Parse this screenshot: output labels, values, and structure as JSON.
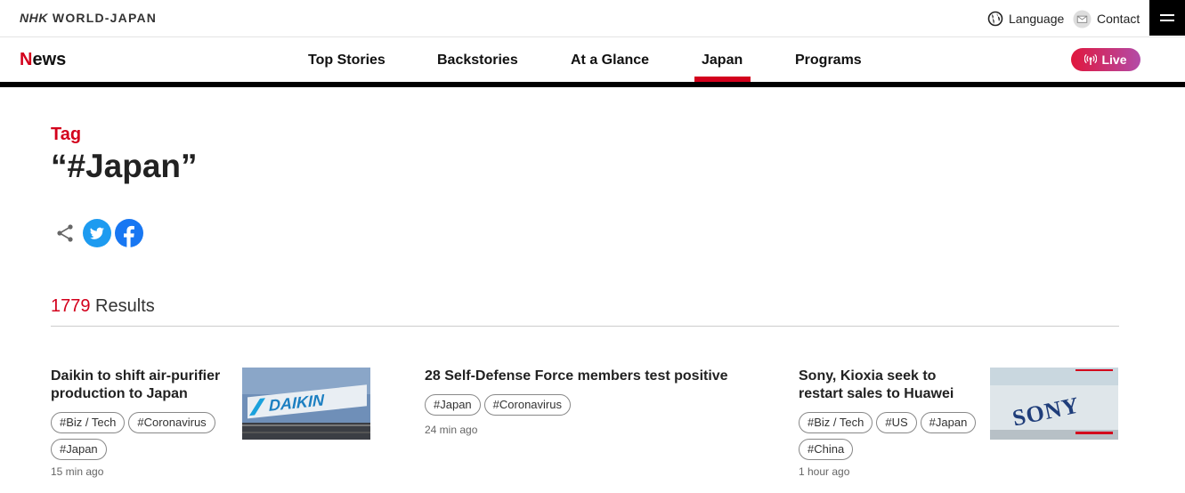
{
  "header": {
    "brand_nhk": "NHK",
    "brand_rest": " WORLD-JAPAN",
    "language_label": "Language",
    "contact_label": "Contact"
  },
  "nav": {
    "logo_first": "N",
    "logo_rest": "ews",
    "items": [
      {
        "label": "Top Stories"
      },
      {
        "label": "Backstories"
      },
      {
        "label": "At a Glance"
      },
      {
        "label": "Japan"
      },
      {
        "label": "Programs"
      }
    ],
    "active": "Japan",
    "live_label": "Live"
  },
  "tag": {
    "label": "Tag",
    "title": "“#Japan”"
  },
  "results": {
    "count": "1779",
    "label": " Results"
  },
  "articles": [
    {
      "title_line1": "Daikin to shift air-purifier",
      "title_line2": "production to Japan",
      "tags": [
        "#Biz / Tech",
        "#Coronavirus",
        "#Japan"
      ],
      "time": "15 min ago",
      "thumb_text": "DAIKIN"
    },
    {
      "title_line1": "28 Self-Defense Force members test positive",
      "tags": [
        "#Japan",
        "#Coronavirus"
      ],
      "time": "24 min ago"
    },
    {
      "title_line1": "Sony, Kioxia seek to",
      "title_line2": "restart sales to Huawei",
      "tags": [
        "#Biz / Tech",
        "#US",
        "#Japan",
        "#China"
      ],
      "time": "1 hour ago",
      "thumb_text": "SONY"
    }
  ],
  "colors": {
    "accent": "#d3001c",
    "twitter": "#1d9bf0",
    "facebook": "#1877f2"
  }
}
